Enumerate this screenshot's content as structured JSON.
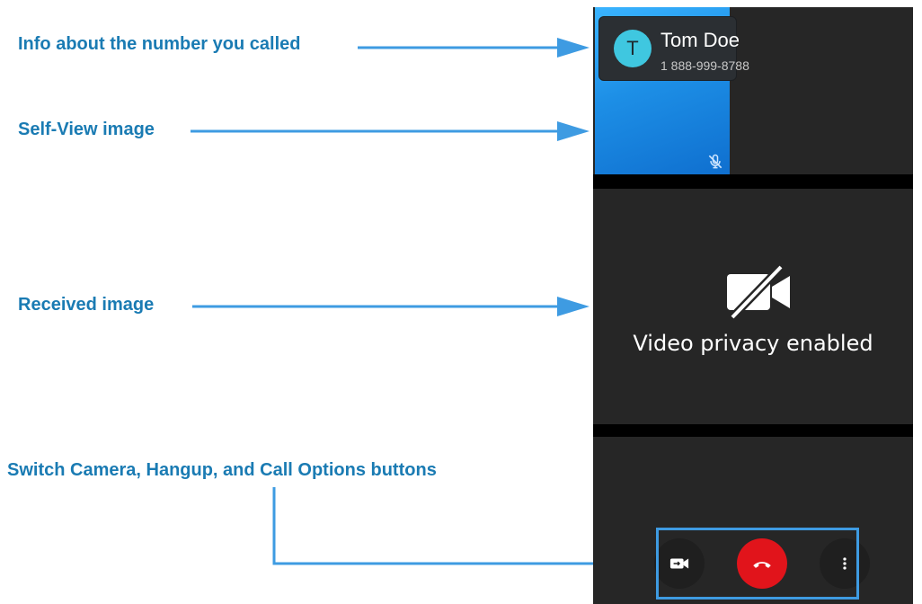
{
  "callouts": {
    "contact_info": "Info about the number you called",
    "self_view": "Self-View image",
    "received": "Received image",
    "buttons": "Switch Camera, Hangup, and Call Options buttons"
  },
  "contact": {
    "initial": "T",
    "name": "Tom Doe",
    "number": "1 888-999-8788"
  },
  "received_pane": {
    "privacy_text": "Video privacy enabled"
  },
  "controls": {
    "switch_camera_icon": "switch-camera-icon",
    "hangup_icon": "phone-hangup-icon",
    "options_icon": "more-vertical-icon"
  },
  "colors": {
    "callout_text": "#1a7bb3",
    "arrow": "#3e9be2",
    "hangup": "#e1141b",
    "avatar": "#3fc7e0",
    "self_view": "#1d8fe6"
  }
}
